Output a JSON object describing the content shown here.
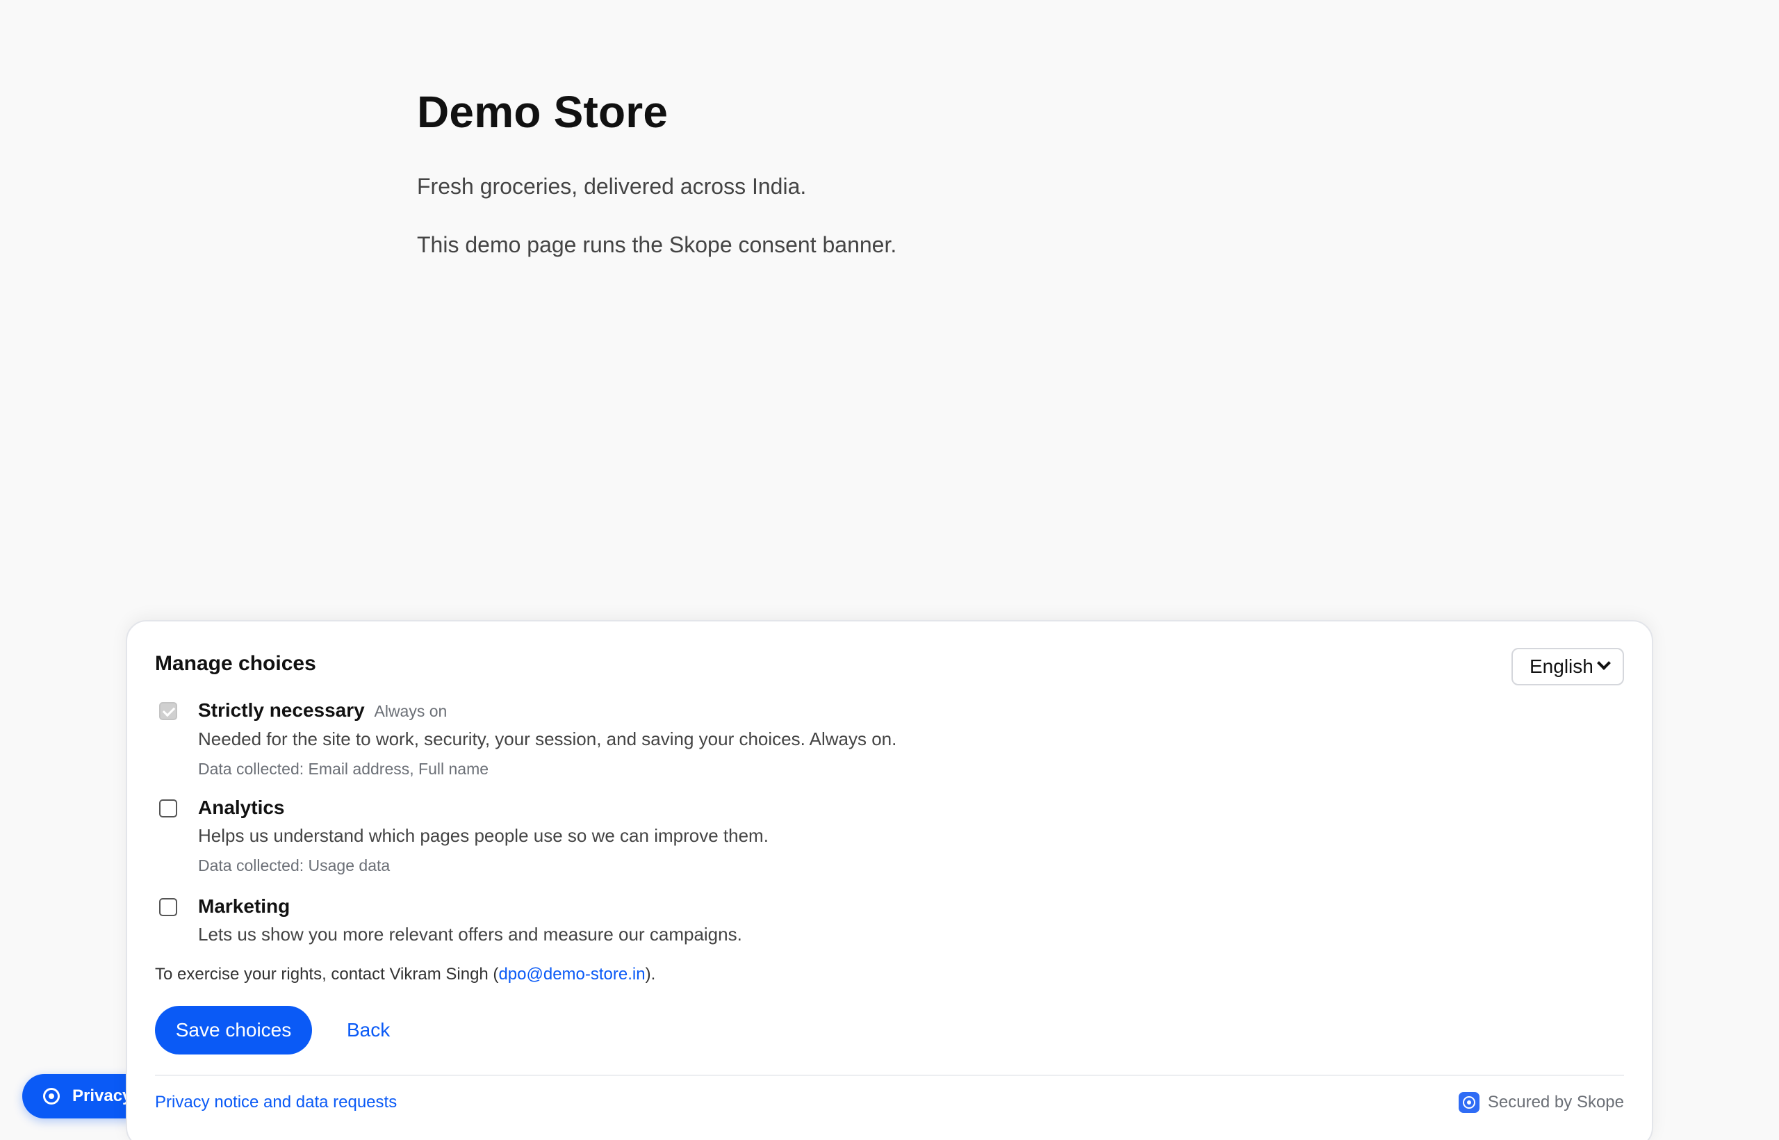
{
  "store": {
    "title": "Demo Store",
    "tagline": "Fresh groceries, delivered across India.",
    "demo_note": "This demo page runs the Skope consent banner."
  },
  "privacy_pill": {
    "label": "Privacy",
    "icon": "privacy-circle-icon"
  },
  "banner": {
    "title": "Manage choices",
    "language": {
      "selected": "English",
      "icon": "chevron-down-icon"
    },
    "purposes": [
      {
        "name": "Strictly necessary",
        "badge": "Always on",
        "description": "Needed for the site to work, security, your session, and saving your choices. Always on.",
        "data_collected": "Data collected: Email address, Full name",
        "checked": true,
        "disabled": true
      },
      {
        "name": "Analytics",
        "description": "Helps us understand which pages people use so we can improve them.",
        "data_collected": "Data collected: Usage data",
        "checked": false,
        "disabled": false
      },
      {
        "name": "Marketing",
        "description": "Lets us show you more relevant offers and measure our campaigns.",
        "checked": false,
        "disabled": false
      }
    ],
    "rights": {
      "prefix": "To exercise your rights, contact Vikram Singh (",
      "email": "dpo@demo-store.in",
      "suffix": ")."
    },
    "save_label": "Save choices",
    "back_label": "Back",
    "footer_link": "Privacy notice and data requests",
    "secured_by": "Secured by Skope",
    "secured_icon": "skope-shield-icon"
  },
  "colors": {
    "accent": "#0a5af6",
    "background": "#f9f9f9",
    "muted_text": "#6b6f76"
  }
}
